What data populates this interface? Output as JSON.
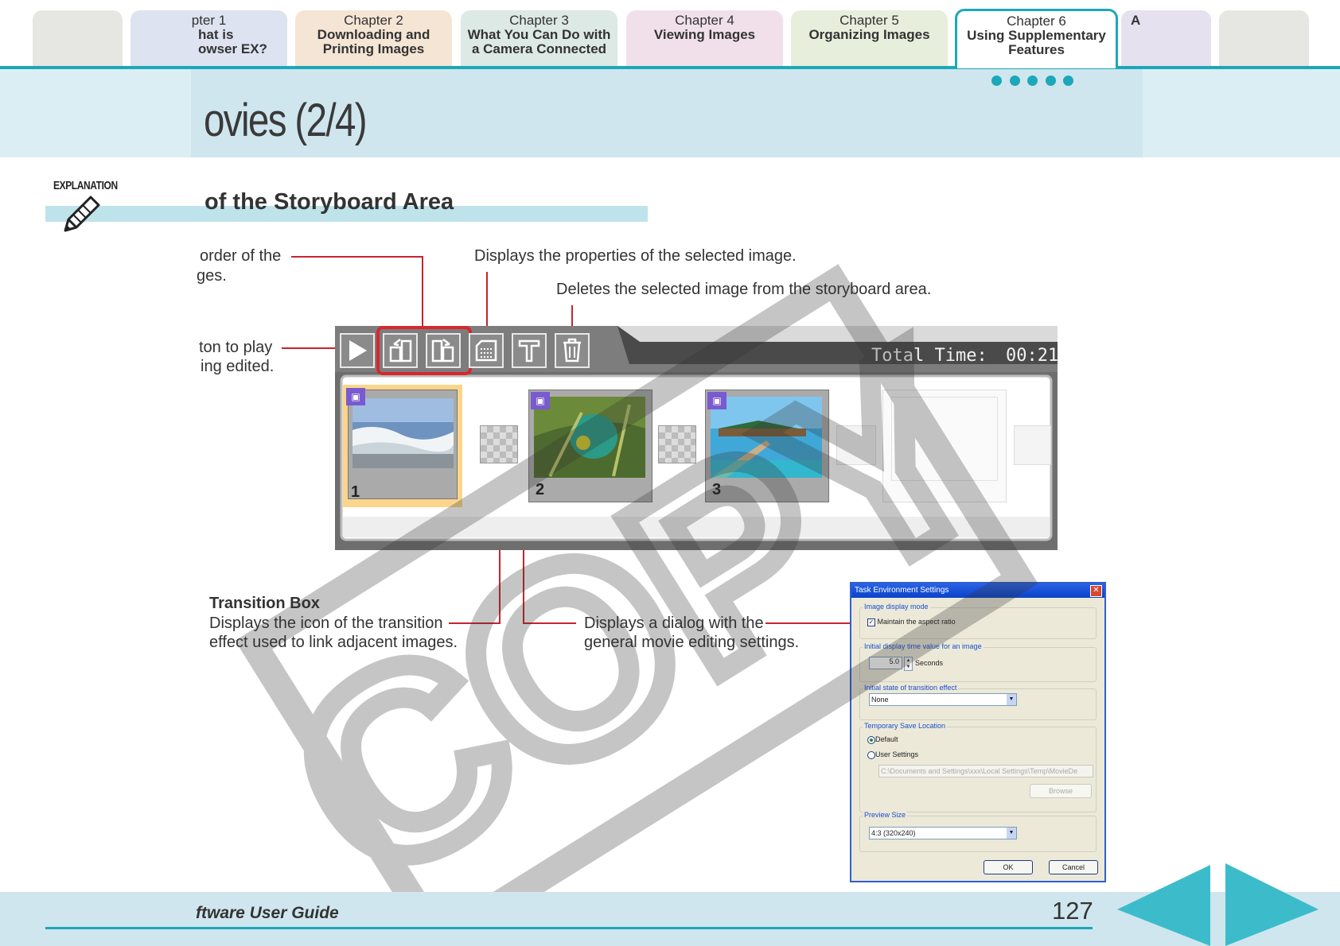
{
  "tabs": [
    {
      "line1": "",
      "line2": ""
    },
    {
      "line1": "pter 1",
      "line2": "hat is"
    },
    {
      "line1": "Chapter 2",
      "line2": "Downloading and"
    },
    {
      "line1": "Chapter 3",
      "line2": "What You Can Do with"
    },
    {
      "line1": "Chapter 4",
      "line2": "Viewing Images"
    },
    {
      "line1": "Chapter 5",
      "line2": "Organizing Images"
    },
    {
      "line1": "Chapter 6",
      "line2": "Using Supplementary"
    },
    {
      "line1": "",
      "line2": "A"
    },
    {
      "line1": "",
      "line2": ""
    }
  ],
  "tab_lines3": [
    "",
    "owser EX?",
    "Printing Images",
    "a Camera Connected",
    "",
    "",
    "Features",
    "",
    ""
  ],
  "tab_colors": [
    "#e6e6e2",
    "#dde3f1",
    "#f5e5d5",
    "#dde9e4",
    "#f1e0ea",
    "#e8eedc",
    "#ffffff",
    "#e6e1ef",
    "#e6e6e2"
  ],
  "header": {
    "title": "ovies (2/4)"
  },
  "section": {
    "label": "EXPLANATION",
    "subtitle": "of the Storyboard Area"
  },
  "annotations": {
    "order_1": "order of the",
    "order_2": "ges.",
    "properties": "Displays the properties of the selected image.",
    "delete": "Deletes the selected image from the storyboard area.",
    "play_1": "ton to play",
    "play_2": "ing edited.",
    "transition_title": "Transition Box",
    "transition_1": "Displays the icon of the transition",
    "transition_2": "effect used to link adjacent images.",
    "dialog_1": "Displays a dialog with the",
    "dialog_2": "general movie editing settings."
  },
  "storyboard": {
    "total_time_label": "Total Time:",
    "total_time_value": "00:21",
    "frames": [
      "1",
      "2",
      "3"
    ]
  },
  "dialog": {
    "title": "Task Environment Settings",
    "image_display_mode": "Image display mode",
    "maintain_aspect": "Maintain the aspect ratio",
    "initial_display_time": "Initial display time value for an image",
    "seconds_value": "5.0",
    "seconds_label": "Seconds",
    "initial_transition": "Initial state of transition effect",
    "transition_value": "None",
    "temp_save": "Temporary Save Location",
    "default": "Default",
    "user_settings": "User Settings",
    "path": "C:\\Documents and Settings\\xxx\\Local Settings\\Temp\\MovieDe",
    "browse": "Browse",
    "preview_size": "Preview Size",
    "preview_value": "4:3 (320x240)",
    "ok": "OK",
    "cancel": "Cancel"
  },
  "watermark": "COPY",
  "footer": {
    "guide": "ftware User Guide",
    "page": "127"
  }
}
